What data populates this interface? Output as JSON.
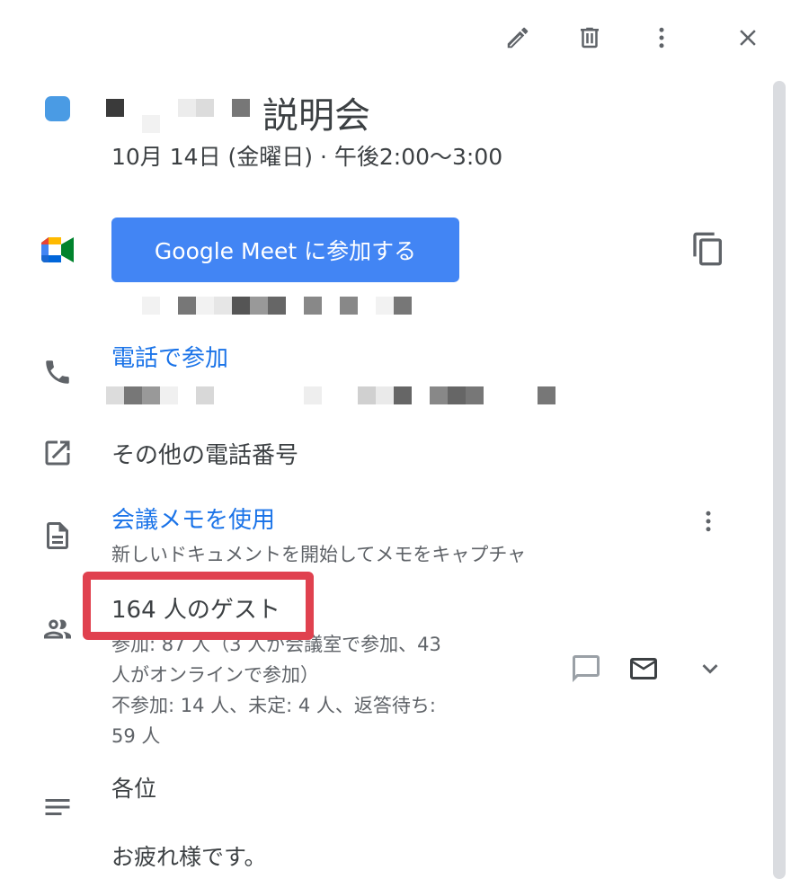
{
  "toolbar": {
    "edit_icon": "pencil-icon",
    "delete_icon": "trash-icon",
    "more_icon": "more-vert-icon",
    "close_icon": "close-icon"
  },
  "event": {
    "color": "#4a9be4",
    "title": "説明会",
    "datetime": "10月 14日 (金曜日)  ·  午後2:00〜3:00"
  },
  "meet": {
    "join_label": "Google Meet に参加する",
    "copy_icon": "copy-icon"
  },
  "phone": {
    "join_label": "電話で参加",
    "more_numbers_label": "その他の電話番号"
  },
  "notes": {
    "label": "会議メモを使用",
    "sub": "新しいドキュメントを開始してメモをキャプチャ"
  },
  "guests": {
    "count_label": "164 人のゲスト",
    "summary_line1": "参加: 87 人（3 人が会議室で参加、43",
    "summary_line2": "人がオンラインで参加）",
    "summary_line3": "不参加: 14 人、未定: 4 人、返答待ち:",
    "summary_line4": "59 人"
  },
  "description": {
    "line1": "各位",
    "line2": "お疲れ様です。"
  },
  "colors": {
    "accent": "#1a73e8",
    "meet_button": "#4285f4",
    "highlight": "#e0414f"
  }
}
